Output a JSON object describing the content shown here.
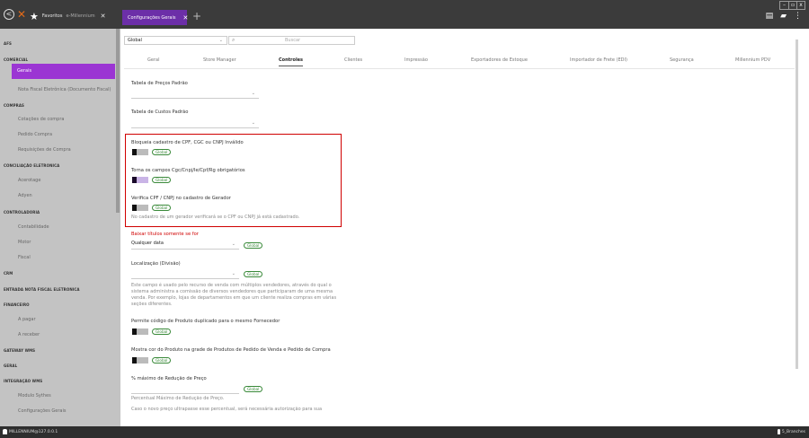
{
  "topbar": {
    "favorites_label": "Favoritos",
    "favorites_sub": "e-Millennium",
    "active_tab_label": "Configurações Gerais",
    "close_symbol": "✕",
    "plus_symbol": "+",
    "win_min": "–",
    "win_max": "▫",
    "win_close": "x"
  },
  "sidebar": {
    "sections": [
      {
        "key": "afs",
        "label": "AFS"
      },
      {
        "key": "comercial",
        "label": "COMERCIAL"
      },
      {
        "key": "compras",
        "label": "COMPRAS"
      },
      {
        "key": "conc",
        "label": "CONCILIAÇÃO ELETRONICA"
      },
      {
        "key": "cont",
        "label": "CONTROLADORIA"
      },
      {
        "key": "crm",
        "label": "CRM"
      },
      {
        "key": "entrada",
        "label": "ENTRADA NOTA FISCAL ELETRONICA"
      },
      {
        "key": "fin",
        "label": "FINANCEIRO"
      },
      {
        "key": "gw",
        "label": "GATEWAY WMS"
      },
      {
        "key": "geral",
        "label": "GERAL"
      },
      {
        "key": "integ",
        "label": "INTEGRAÇÃO WMS"
      }
    ],
    "items": {
      "gerais": "Gerais",
      "nf": "Nota Fiscal Eletrônica (Documento Fiscal)",
      "cotacoes": "Cotações de compra",
      "pedido": "Pedido Compra",
      "requisicoes": "Requisições de Compra",
      "acerotage": "Acerotage",
      "adyen": "Adyen",
      "contabilidade": "Contabilidade",
      "motor": "Motor",
      "fiscal": "Fiscal",
      "apagar": "A pagar",
      "areceber": "A receber",
      "sythes": "Modulo Sythes",
      "confgerais": "Configurações Gerais"
    }
  },
  "main": {
    "module_select": "Global",
    "search_placeholder": "Buscar",
    "tabs": [
      "Geral",
      "Store Manager",
      "Controles",
      "Clientes",
      "Impressão",
      "Exportadores de Estoque",
      "Importador de Frete (EDI)",
      "Segurança",
      "Millennium PDV"
    ],
    "fields": {
      "tabela_precos": "Tabela de Preços Padrão",
      "tabela_custos": "Tabela de Custos Padrão",
      "bloqueia": "Bloqueia cadastro de CPF, CGC ou CNPJ Inválido",
      "torna": "Torna os campos Cgc/Cnpj/Ie/Cpf/Rg obrigatórios",
      "verifica": "Verifica CPF / CNPJ no cadastro de Gerador",
      "verifica_help": "No cadastro de um gerador verificará se o CPF ou CNPJ já está cadastrado.",
      "baixar": "Baixar títulos somente se for",
      "baixar_value": "Qualquer data",
      "localizacao": "Localização (Divisão)",
      "loc_help_1": "Este campo é usado pelo recurso de venda com múltiplos vendedores, através do qual o",
      "loc_help_2": "sistema administra a comissão de diversos vendedores que participaram de uma mesma",
      "loc_help_3": "venda. Por exemplo, lojas de departamentos em que um cliente realiza compras em várias",
      "loc_help_4": "seções diferentes.",
      "permite": "Permite código de Produto duplicado para o mesmo Fornecedor",
      "mostra": "Mostra cor do Produto na grade de Produtos de Pedido de Venda e Pedido de Compra",
      "percentual": "% máximo de Redução de Preço",
      "perc_help": "Percentual Máximo de Redução de Preço.",
      "perc_help2": "Caso o novo preço ultrapasse esse percentual, será necessária autorização para sua"
    },
    "badge": "Global"
  },
  "status": {
    "left": "MILLENNIUM@127.0.0.1",
    "right": "5_Branches"
  },
  "colors": {
    "accent": "#9b35d3",
    "tab": "#6c2fa8",
    "highlight": "#d00000"
  }
}
